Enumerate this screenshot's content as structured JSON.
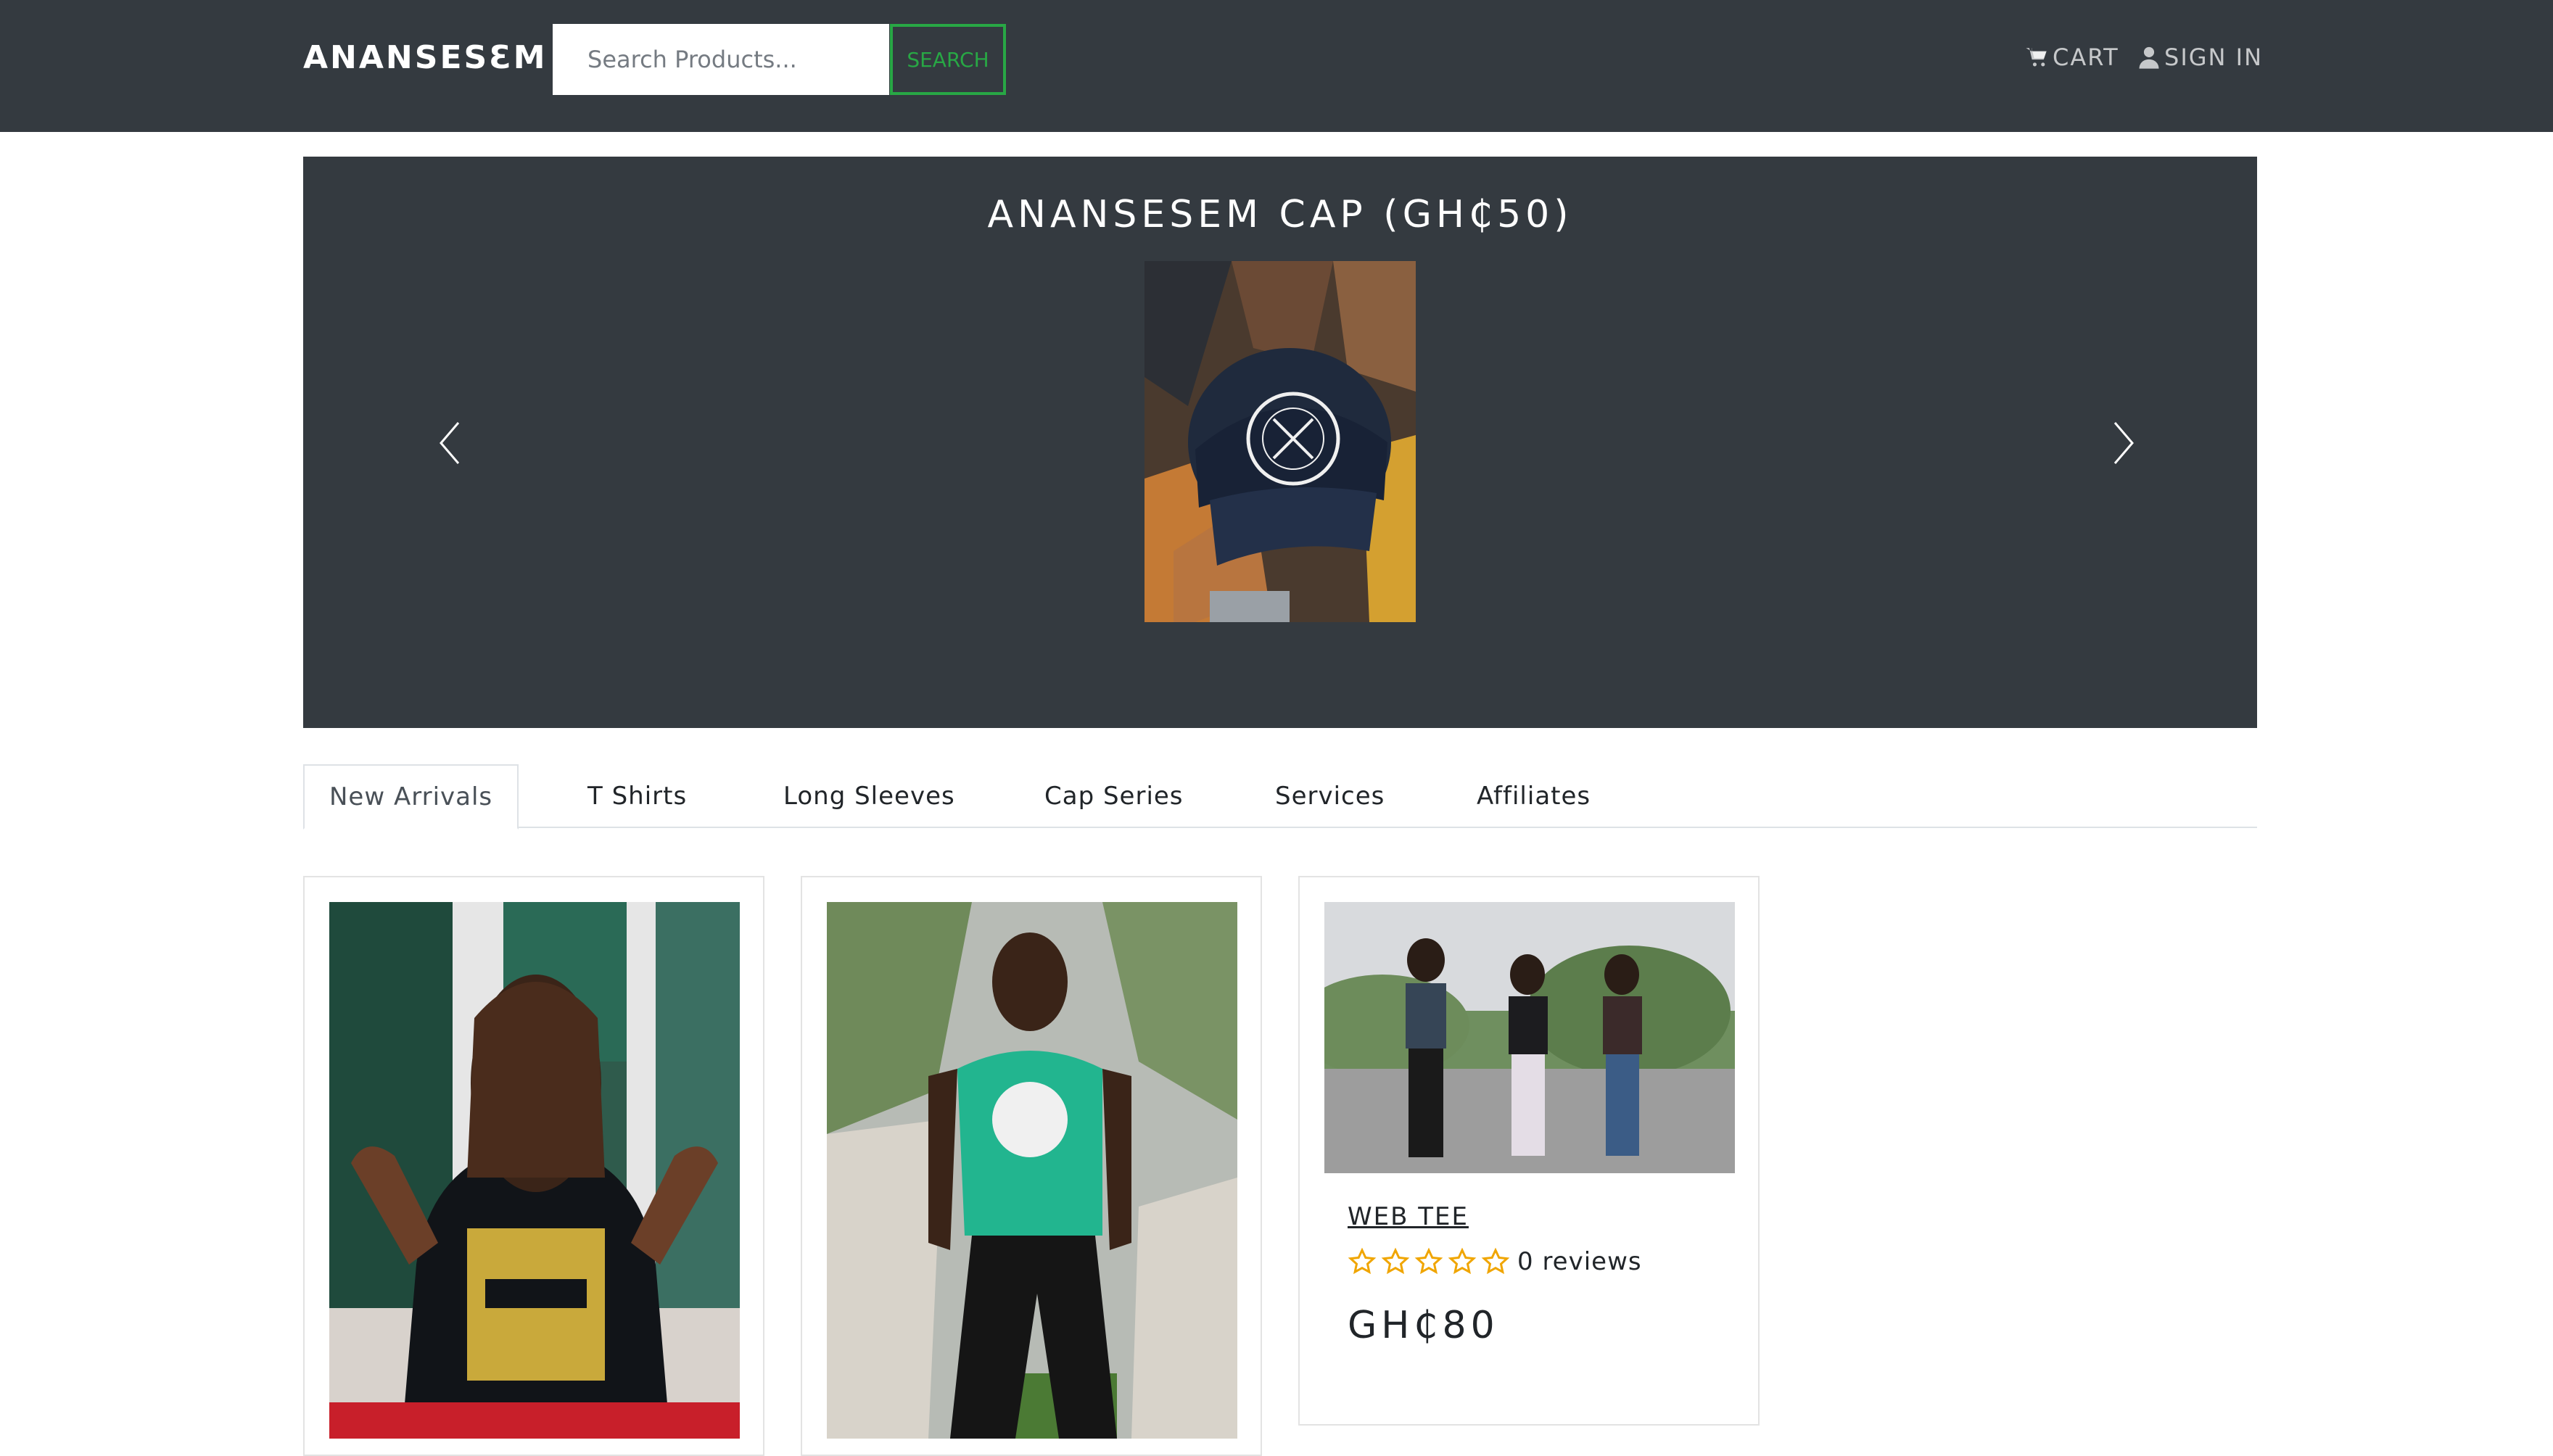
{
  "navbar": {
    "brand": "ANANSESƐM",
    "search_placeholder": "Search Products...",
    "search_button": "SEARCH",
    "cart_label": "CART",
    "signin_label": "SIGN IN"
  },
  "carousel": {
    "title": "ANANSESEM CAP (GH₵50)",
    "image_alt": "Cap with ANANSESEM WEAR logo"
  },
  "tabs": [
    {
      "label": "New Arrivals",
      "active": true
    },
    {
      "label": "T Shirts"
    },
    {
      "label": "Long Sleeves"
    },
    {
      "label": "Cap Series"
    },
    {
      "label": "Services"
    },
    {
      "label": "Affiliates"
    }
  ],
  "products": [
    {
      "image": "black Ghana print tee"
    },
    {
      "image": "green Love Me Like Jollof tee"
    },
    {
      "image": "three friends in tees",
      "name": "WEB TEE",
      "reviews": "0 reviews",
      "rating": 0,
      "price": "GH₵80"
    }
  ],
  "colors": {
    "navbar_bg": "#343a40",
    "accent_green": "#28a745",
    "star": "#f0a500"
  },
  "icons": [
    "cart-icon",
    "user-icon",
    "chevron-left-icon",
    "chevron-right-icon",
    "star-outline-icon"
  ]
}
